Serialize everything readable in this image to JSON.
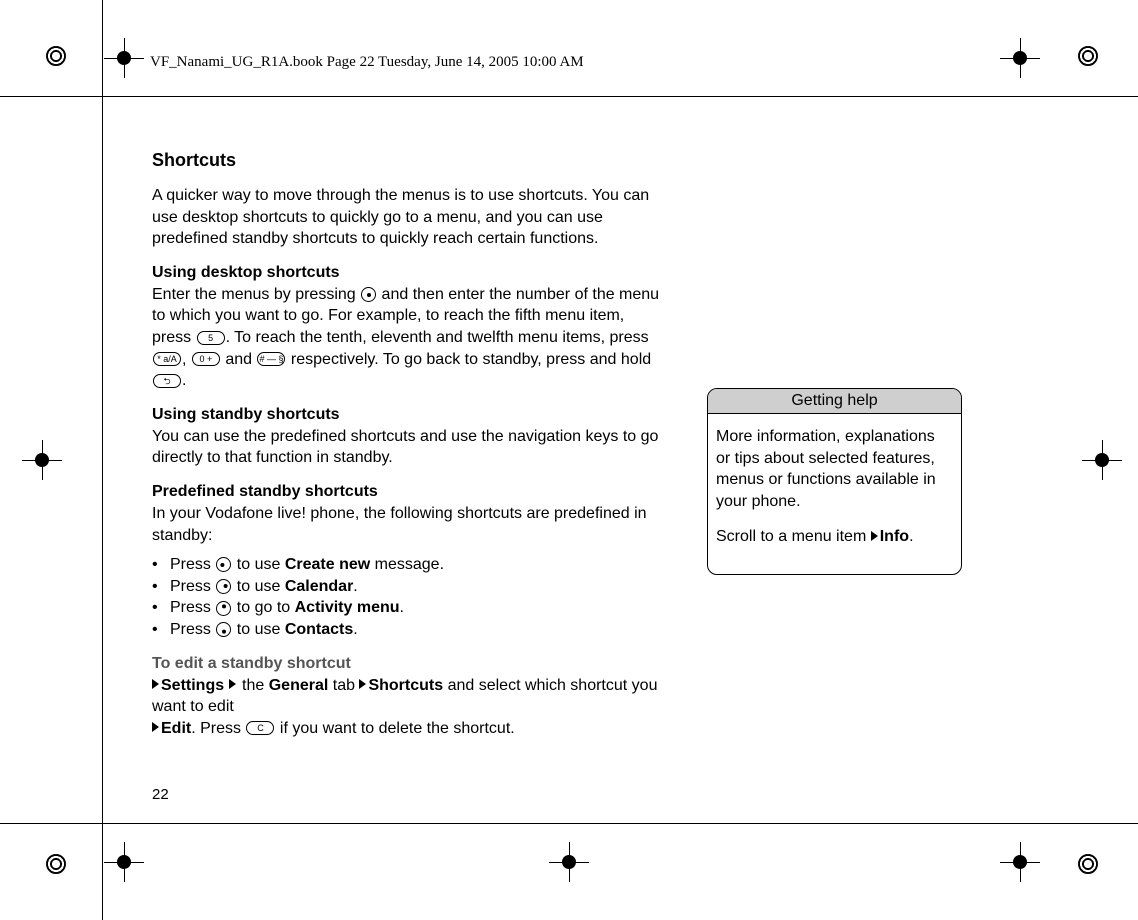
{
  "header": {
    "crop_info": "VF_Nanami_UG_R1A.book  Page 22  Tuesday, June 14, 2005  10:00 AM"
  },
  "section_title": "Shortcuts",
  "intro": "A quicker way to move through the menus is to use shortcuts. You can use desktop shortcuts to quickly go to a menu, and you can use predefined standby shortcuts to quickly reach certain functions.",
  "desktop": {
    "heading": "Using desktop shortcuts",
    "p1a": "Enter the menus by pressing ",
    "p1b": " and then enter the number of the menu to which you want to go. For example, to reach the fifth menu item, press ",
    "p1c": ". To reach the tenth, eleventh and twelfth menu items, press ",
    "p1d": ", ",
    "p1e": " and ",
    "p1f": " respectively. To go back to standby, press and hold ",
    "p1g": "."
  },
  "standby": {
    "heading": "Using standby shortcuts",
    "body": "You can use the predefined shortcuts and use the navigation keys to go directly to that function in standby."
  },
  "predef": {
    "heading": "Predefined standby shortcuts",
    "intro": "In your Vodafone live! phone, the following shortcuts are predefined in standby:",
    "items": [
      {
        "pre": "Press ",
        "mid": " to use ",
        "bold": "Create new",
        "post": " message."
      },
      {
        "pre": "Press ",
        "mid": " to use ",
        "bold": "Calendar",
        "post": "."
      },
      {
        "pre": "Press ",
        "mid": " to go to ",
        "bold": "Activity menu",
        "post": "."
      },
      {
        "pre": "Press ",
        "mid": " to use ",
        "bold": "Contacts",
        "post": "."
      }
    ]
  },
  "edit": {
    "heading": "To edit a standby shortcut",
    "s": "Settings",
    "g1": " the ",
    "g": "General",
    "g2": " tab ",
    "sc": "Shortcuts",
    "sc2": " and select which shortcut you want to edit ",
    "ed": "Edit",
    "p2a": ". Press ",
    "p2b": " if you want to delete the shortcut."
  },
  "sidebox": {
    "title": "Getting help",
    "body1": "More information, explanations or tips about selected features, menus or functions available in your phone.",
    "body2a": "Scroll to a menu item ",
    "body2b": "Info",
    "body2c": "."
  },
  "keys": {
    "five": "5",
    "star": "* a/A",
    "zero": "0  +",
    "hash": "# — §",
    "back": "⮌",
    "c": "C"
  },
  "page_number": "22"
}
